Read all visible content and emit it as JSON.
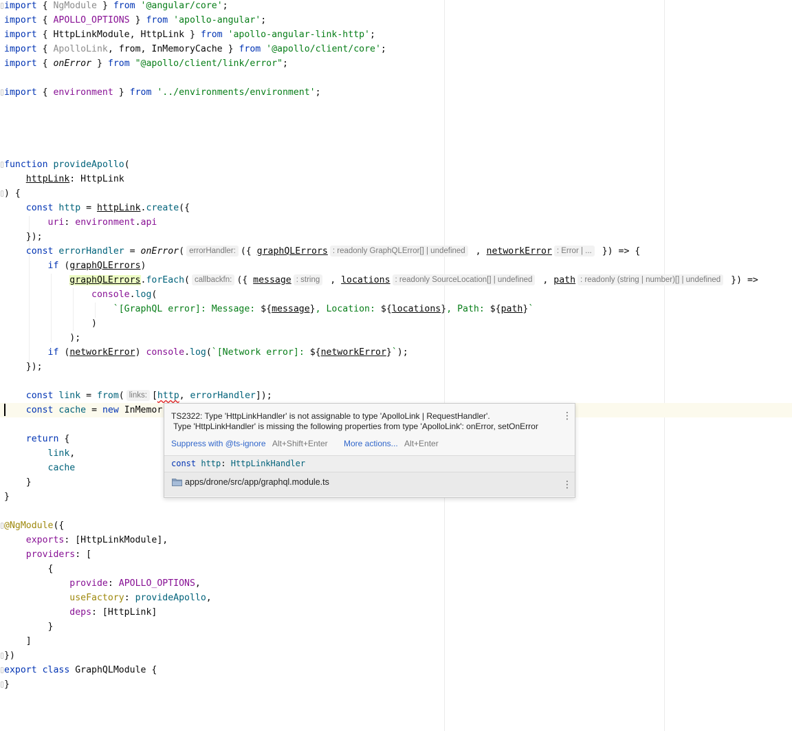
{
  "editor": {
    "file_path": "apps/drone/src/app/graphql.module.ts"
  },
  "code": {
    "l1": {
      "a": "import",
      "b": " { ",
      "c": "NgModule",
      "d": " } ",
      "e": "from",
      "f": " ",
      "g": "'@angular/core'",
      "h": ";"
    },
    "l2": {
      "a": "import",
      "b": " { ",
      "c": "APOLLO_OPTIONS",
      "d": " } ",
      "e": "from",
      "f": " ",
      "g": "'apollo-angular'",
      "h": ";"
    },
    "l3": {
      "a": "import",
      "b": " { HttpLinkModule, HttpLink } ",
      "e": "from",
      "f": " ",
      "g": "'apollo-angular-link-http'",
      "h": ";"
    },
    "l4": {
      "a": "import",
      "b": " { ",
      "c": "ApolloLink",
      "d": ", ",
      "c2": "from",
      "d2": ", InMemoryCache } ",
      "e": "from",
      "f": " ",
      "g": "'@apollo/client/core'",
      "h": ";"
    },
    "l5": {
      "a": "import",
      "b": " { ",
      "c": "onError",
      "d": " } ",
      "e": "from",
      "f": " ",
      "g": "\"@apollo/client/link/error\"",
      "h": ";"
    },
    "l6": {
      "a": "import",
      "b": " { ",
      "c": "environment",
      "d": " } ",
      "e": "from",
      "f": " ",
      "g": "'../environments/environment'",
      "h": ";"
    },
    "l7": {
      "a": "function",
      "b": " ",
      "c": "provideApollo",
      "d": "("
    },
    "l8": {
      "a": "    ",
      "b": "httpLink",
      "c": ": HttpLink"
    },
    "l9": {
      "a": ") {"
    },
    "l10": {
      "a": "    ",
      "b": "const",
      "c": " ",
      "d": "http",
      "e": " = ",
      "f": "httpLink",
      "g": ".",
      "h": "create",
      "i": "({"
    },
    "l11": {
      "a": "        ",
      "b": "uri",
      "c": ": ",
      "d": "environment",
      "e": ".",
      "f": "api"
    },
    "l12": {
      "a": "    });"
    },
    "l13": {
      "a": "    ",
      "b": "const",
      "c": " ",
      "d": "errorHandler",
      "e": " = ",
      "f": "onError",
      "g": "(",
      "h1": "errorHandler:",
      "i": "({ ",
      "j": "graphQLErrors",
      "h2": ": readonly GraphQLError[] | undefined",
      "k": " , ",
      "l": "networkError",
      "h3": ": Error | ...",
      "m": " }) => {"
    },
    "l14": {
      "a": "        ",
      "b": "if",
      "c": " (",
      "d": "graphQLErrors",
      "e": ")"
    },
    "l15": {
      "a": "            ",
      "b": "graphQLErrors",
      "c": ".",
      "d": "forEach",
      "e": "(",
      "h1": "callbackfn:",
      "f": "({ ",
      "g": "message",
      "h2": ": string",
      "i": " , ",
      "j": "locations",
      "h3": ": readonly SourceLocation[] | undefined",
      "k": " , ",
      "l": "path",
      "h4": ": readonly (string | number)[] | undefined",
      "m": " }) =>"
    },
    "l16": {
      "a": "                ",
      "b": "console",
      "c": ".",
      "d": "log",
      "e": "("
    },
    "l17": {
      "a": "                    ",
      "b": "`[GraphQL error]: Message: ",
      "c": "${",
      "d": "message",
      "e": "}",
      "f": ", Location: ",
      "g": "${",
      "h": "locations",
      "i": "}",
      "j": ", Path: ",
      "k": "${",
      "l": "path",
      "m": "}",
      "n": "`"
    },
    "l18": {
      "a": "                )"
    },
    "l19": {
      "a": "            );"
    },
    "l20": {
      "a": "        ",
      "b": "if",
      "c": " (",
      "d": "networkError",
      "e": ") ",
      "f": "console",
      "g": ".",
      "h": "log",
      "i": "(",
      "j": "`[Network error]: ",
      "k": "${",
      "l": "networkError",
      "m": "}",
      "n": "`",
      "o": ");"
    },
    "l21": {
      "a": "    });"
    },
    "l22": {
      "a": "    ",
      "b": "const",
      "c": " ",
      "d": "link",
      "e": " = ",
      "f": "from",
      "g": "(",
      "h1": "links:",
      "i": "[",
      "j": "http",
      "k": ", ",
      "l": "errorHandler",
      "m": "]);"
    },
    "l23": {
      "a": "    ",
      "b": "const",
      "c": " ",
      "d": "cache",
      "e": " = ",
      "f": "new",
      "g": " InMemor"
    },
    "l24": {
      "a": "    ",
      "b": "return",
      "c": " {"
    },
    "l25": {
      "a": "        ",
      "b": "link",
      "c": ","
    },
    "l26": {
      "a": "        ",
      "b": "cache"
    },
    "l27": {
      "a": "    }"
    },
    "l28": {
      "a": "}"
    },
    "l29": {
      "a": "@NgModule",
      "b": "({"
    },
    "l30": {
      "a": "    ",
      "b": "exports",
      "c": ": [HttpLinkModule],"
    },
    "l31": {
      "a": "    ",
      "b": "providers",
      "c": ": ["
    },
    "l32": {
      "a": "        {"
    },
    "l33": {
      "a": "            ",
      "b": "provide",
      "c": ": ",
      "d": "APOLLO_OPTIONS",
      "e": ","
    },
    "l34": {
      "a": "            ",
      "b": "useFactory",
      "c": ": ",
      "d": "provideApollo",
      "e": ","
    },
    "l35": {
      "a": "            ",
      "b": "deps",
      "c": ": [HttpLink]"
    },
    "l36": {
      "a": "        }"
    },
    "l37": {
      "a": "    ]"
    },
    "l38": {
      "a": "})"
    },
    "l39": {
      "a": "export",
      "b": " ",
      "c": "class",
      "d": " GraphQLModule {"
    },
    "l40": {
      "a": "}"
    }
  },
  "popup": {
    "message_line1": "TS2322: Type 'HttpLinkHandler' is not assignable to type 'ApolloLink | RequestHandler'.",
    "message_line2": " Type 'HttpLinkHandler' is missing the following properties from type 'ApolloLink': onError, setOnError",
    "action_suppress": "Suppress with @ts-ignore",
    "action_suppress_shortcut": "Alt+Shift+Enter",
    "action_more": "More actions...",
    "action_more_shortcut": "Alt+Enter",
    "signature_kw": "const",
    "signature_name": "http",
    "signature_sep": ": ",
    "signature_type": "HttpLinkHandler",
    "file": "apps/drone/src/app/graphql.module.ts",
    "icons": {
      "menu": "more-vertical-icon",
      "folder": "folder-icon"
    }
  },
  "colors": {
    "keyword": "#0033b3",
    "string": "#067d17",
    "property": "#871094",
    "function": "#00627a",
    "decorator": "#9e880d",
    "error_underline": "#e01b1b",
    "link": "#2f65ca"
  }
}
